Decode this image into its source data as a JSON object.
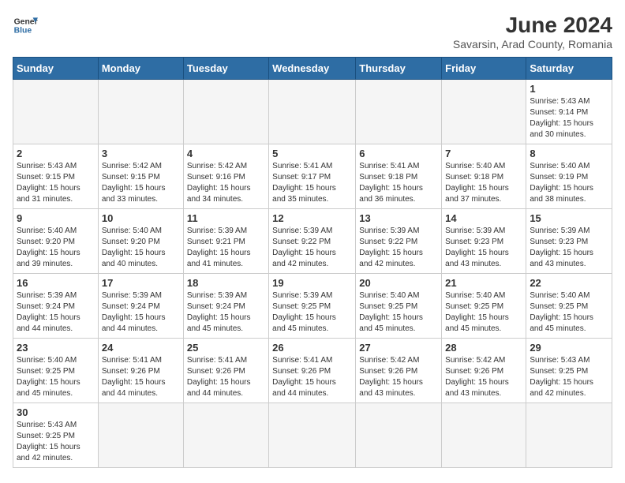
{
  "header": {
    "logo_line1": "General",
    "logo_line2": "Blue",
    "title": "June 2024",
    "subtitle": "Savarsin, Arad County, Romania"
  },
  "weekdays": [
    "Sunday",
    "Monday",
    "Tuesday",
    "Wednesday",
    "Thursday",
    "Friday",
    "Saturday"
  ],
  "weeks": [
    [
      {
        "day": "",
        "info": ""
      },
      {
        "day": "",
        "info": ""
      },
      {
        "day": "",
        "info": ""
      },
      {
        "day": "",
        "info": ""
      },
      {
        "day": "",
        "info": ""
      },
      {
        "day": "",
        "info": ""
      },
      {
        "day": "1",
        "info": "Sunrise: 5:43 AM\nSunset: 9:14 PM\nDaylight: 15 hours\nand 30 minutes."
      }
    ],
    [
      {
        "day": "2",
        "info": "Sunrise: 5:43 AM\nSunset: 9:15 PM\nDaylight: 15 hours\nand 31 minutes."
      },
      {
        "day": "3",
        "info": "Sunrise: 5:42 AM\nSunset: 9:15 PM\nDaylight: 15 hours\nand 33 minutes."
      },
      {
        "day": "4",
        "info": "Sunrise: 5:42 AM\nSunset: 9:16 PM\nDaylight: 15 hours\nand 34 minutes."
      },
      {
        "day": "5",
        "info": "Sunrise: 5:41 AM\nSunset: 9:17 PM\nDaylight: 15 hours\nand 35 minutes."
      },
      {
        "day": "6",
        "info": "Sunrise: 5:41 AM\nSunset: 9:18 PM\nDaylight: 15 hours\nand 36 minutes."
      },
      {
        "day": "7",
        "info": "Sunrise: 5:40 AM\nSunset: 9:18 PM\nDaylight: 15 hours\nand 37 minutes."
      },
      {
        "day": "8",
        "info": "Sunrise: 5:40 AM\nSunset: 9:19 PM\nDaylight: 15 hours\nand 38 minutes."
      }
    ],
    [
      {
        "day": "9",
        "info": "Sunrise: 5:40 AM\nSunset: 9:20 PM\nDaylight: 15 hours\nand 39 minutes."
      },
      {
        "day": "10",
        "info": "Sunrise: 5:40 AM\nSunset: 9:20 PM\nDaylight: 15 hours\nand 40 minutes."
      },
      {
        "day": "11",
        "info": "Sunrise: 5:39 AM\nSunset: 9:21 PM\nDaylight: 15 hours\nand 41 minutes."
      },
      {
        "day": "12",
        "info": "Sunrise: 5:39 AM\nSunset: 9:22 PM\nDaylight: 15 hours\nand 42 minutes."
      },
      {
        "day": "13",
        "info": "Sunrise: 5:39 AM\nSunset: 9:22 PM\nDaylight: 15 hours\nand 42 minutes."
      },
      {
        "day": "14",
        "info": "Sunrise: 5:39 AM\nSunset: 9:23 PM\nDaylight: 15 hours\nand 43 minutes."
      },
      {
        "day": "15",
        "info": "Sunrise: 5:39 AM\nSunset: 9:23 PM\nDaylight: 15 hours\nand 43 minutes."
      }
    ],
    [
      {
        "day": "16",
        "info": "Sunrise: 5:39 AM\nSunset: 9:24 PM\nDaylight: 15 hours\nand 44 minutes."
      },
      {
        "day": "17",
        "info": "Sunrise: 5:39 AM\nSunset: 9:24 PM\nDaylight: 15 hours\nand 44 minutes."
      },
      {
        "day": "18",
        "info": "Sunrise: 5:39 AM\nSunset: 9:24 PM\nDaylight: 15 hours\nand 45 minutes."
      },
      {
        "day": "19",
        "info": "Sunrise: 5:39 AM\nSunset: 9:25 PM\nDaylight: 15 hours\nand 45 minutes."
      },
      {
        "day": "20",
        "info": "Sunrise: 5:40 AM\nSunset: 9:25 PM\nDaylight: 15 hours\nand 45 minutes."
      },
      {
        "day": "21",
        "info": "Sunrise: 5:40 AM\nSunset: 9:25 PM\nDaylight: 15 hours\nand 45 minutes."
      },
      {
        "day": "22",
        "info": "Sunrise: 5:40 AM\nSunset: 9:25 PM\nDaylight: 15 hours\nand 45 minutes."
      }
    ],
    [
      {
        "day": "23",
        "info": "Sunrise: 5:40 AM\nSunset: 9:25 PM\nDaylight: 15 hours\nand 45 minutes."
      },
      {
        "day": "24",
        "info": "Sunrise: 5:41 AM\nSunset: 9:26 PM\nDaylight: 15 hours\nand 44 minutes."
      },
      {
        "day": "25",
        "info": "Sunrise: 5:41 AM\nSunset: 9:26 PM\nDaylight: 15 hours\nand 44 minutes."
      },
      {
        "day": "26",
        "info": "Sunrise: 5:41 AM\nSunset: 9:26 PM\nDaylight: 15 hours\nand 44 minutes."
      },
      {
        "day": "27",
        "info": "Sunrise: 5:42 AM\nSunset: 9:26 PM\nDaylight: 15 hours\nand 43 minutes."
      },
      {
        "day": "28",
        "info": "Sunrise: 5:42 AM\nSunset: 9:26 PM\nDaylight: 15 hours\nand 43 minutes."
      },
      {
        "day": "29",
        "info": "Sunrise: 5:43 AM\nSunset: 9:25 PM\nDaylight: 15 hours\nand 42 minutes."
      }
    ],
    [
      {
        "day": "30",
        "info": "Sunrise: 5:43 AM\nSunset: 9:25 PM\nDaylight: 15 hours\nand 42 minutes."
      },
      {
        "day": "",
        "info": ""
      },
      {
        "day": "",
        "info": ""
      },
      {
        "day": "",
        "info": ""
      },
      {
        "day": "",
        "info": ""
      },
      {
        "day": "",
        "info": ""
      },
      {
        "day": "",
        "info": ""
      }
    ]
  ]
}
